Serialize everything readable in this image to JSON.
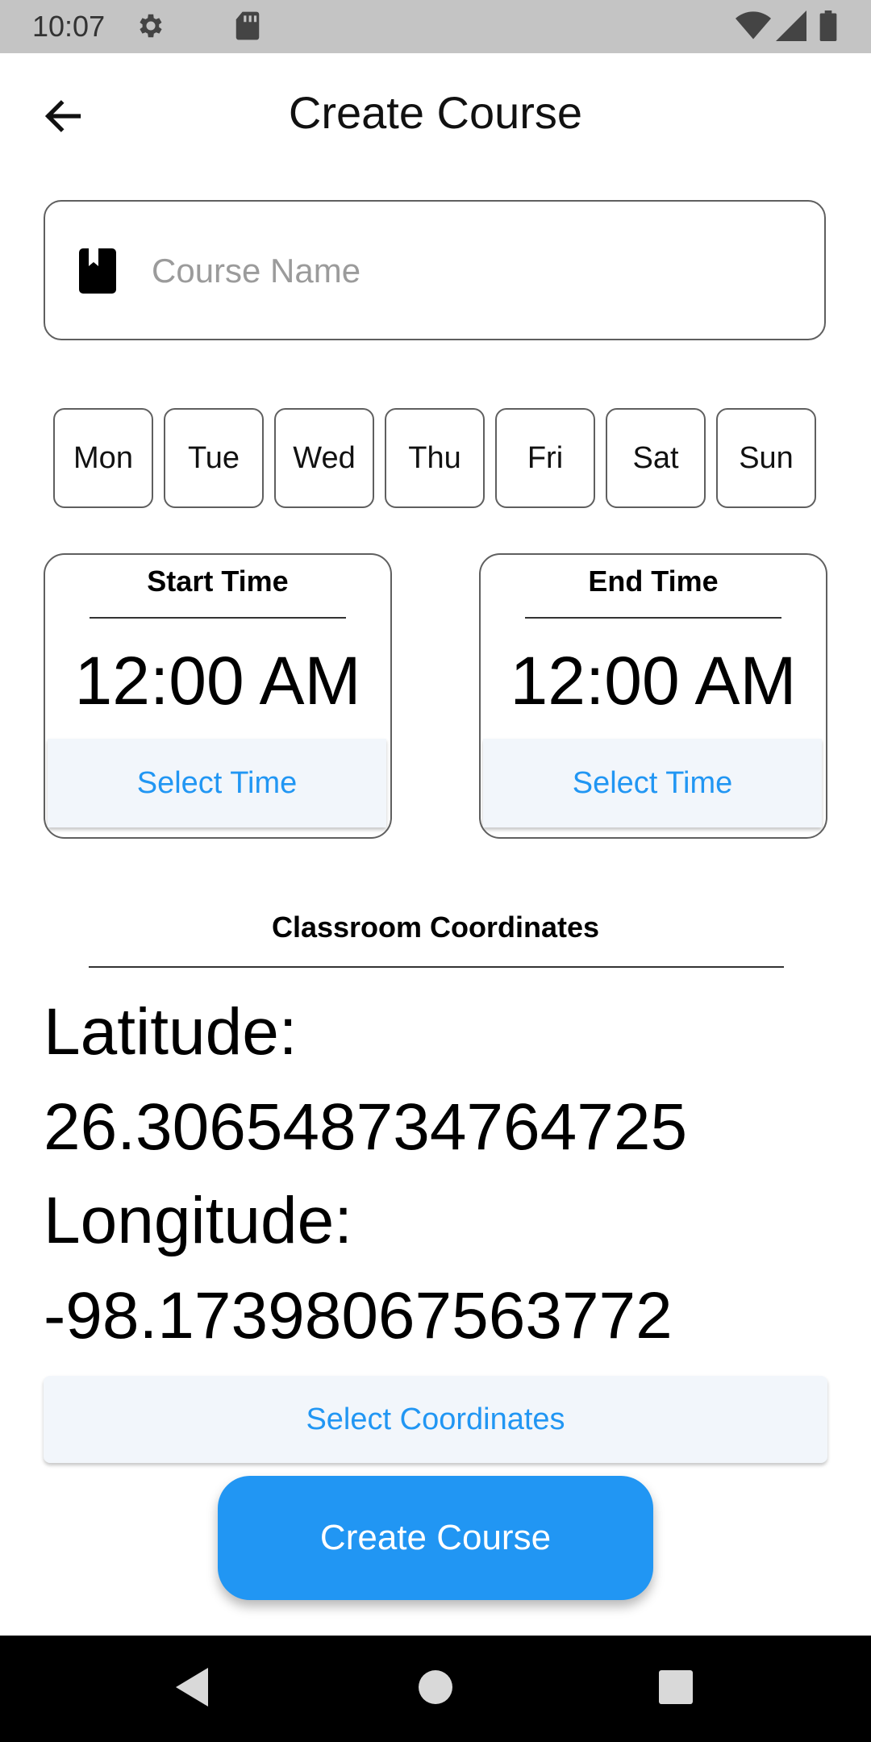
{
  "status_bar": {
    "time": "10:07",
    "icons": [
      "settings-icon",
      "sd-card-icon",
      "wifi-icon",
      "signal-icon",
      "battery-icon"
    ]
  },
  "app_bar": {
    "title": "Create Course",
    "back_icon": "arrow-back-icon"
  },
  "course_name": {
    "icon": "book-icon",
    "value": "",
    "placeholder": "Course Name"
  },
  "days": [
    "Mon",
    "Tue",
    "Wed",
    "Thu",
    "Fri",
    "Sat",
    "Sun"
  ],
  "start_time": {
    "label": "Start Time",
    "value": "12:00 AM",
    "button": "Select Time"
  },
  "end_time": {
    "label": "End Time",
    "value": "12:00 AM",
    "button": "Select Time"
  },
  "coordinates": {
    "title": "Classroom Coordinates",
    "latitude_label": "Latitude:",
    "latitude_value": "26.306548734764725",
    "longitude_label": "Longitude:",
    "longitude_value": "-98.17398067563772",
    "button": "Select Coordinates"
  },
  "create_button": "Create Course",
  "nav_bar": {
    "icons": [
      "nav-back-icon",
      "nav-home-icon",
      "nav-recents-icon"
    ]
  },
  "colors": {
    "accent": "#2196f3",
    "status_bar": "#c4c4c4",
    "button_tint": "#f2f6fb",
    "nav_bar": "#000000"
  }
}
